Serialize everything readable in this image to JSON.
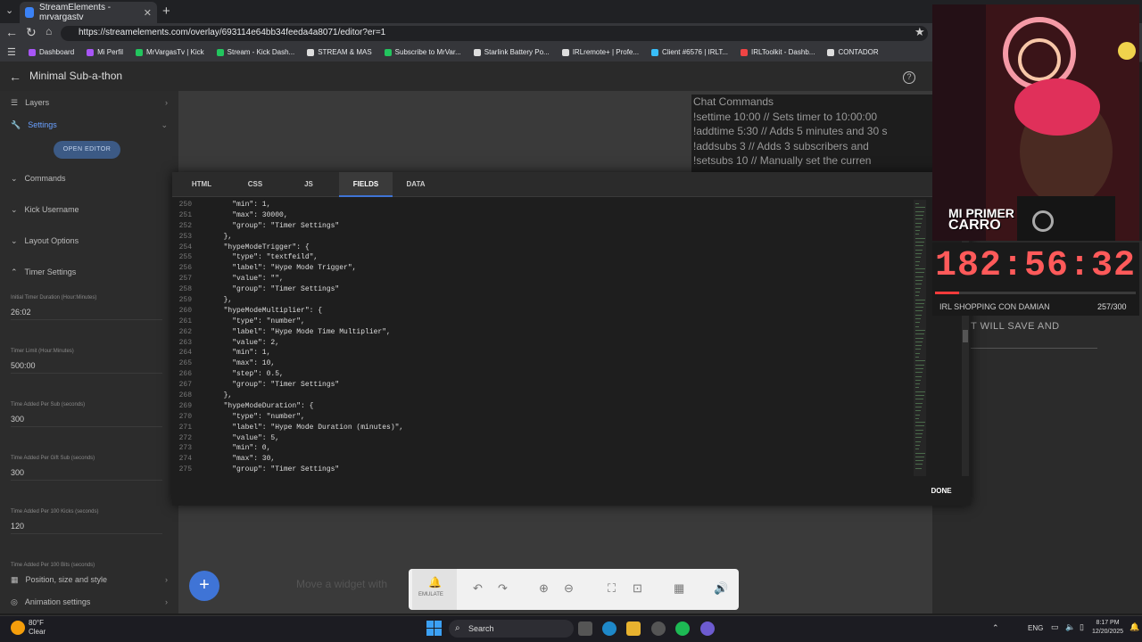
{
  "browser": {
    "tab_title": "StreamElements - mrvargastv",
    "url": "https://streamelements.com/overlay/693114e64bb34feeda4a8071/editor?er=1",
    "bookmarks": [
      {
        "label": "Dashboard",
        "color": "#a855f7"
      },
      {
        "label": "Mi Perfil",
        "color": "#a855f7"
      },
      {
        "label": "MrVargasTv | Kick",
        "color": "#22c55e"
      },
      {
        "label": "Stream - Kick Dash...",
        "color": "#22c55e"
      },
      {
        "label": "STREAM & MAS",
        "color": "#ddd"
      },
      {
        "label": "Subscribe to MrVar...",
        "color": "#22c55e"
      },
      {
        "label": "Starlink Battery Po...",
        "color": "#ddd"
      },
      {
        "label": "IRLremote+ | Profe...",
        "color": "#ddd"
      },
      {
        "label": "Client #6576 | IRLT...",
        "color": "#38bdf8"
      },
      {
        "label": "IRLToolkit - Dashb...",
        "color": "#ef4444"
      },
      {
        "label": "CONTADOR",
        "color": "#ddd"
      }
    ]
  },
  "editor": {
    "overlay_title": "Minimal Sub-a-thon",
    "sidebar": {
      "layers": "Layers",
      "settings": "Settings",
      "open_editor": "OPEN EDITOR",
      "sections": [
        "Commands",
        "Kick Username",
        "Layout Options",
        "Timer Settings"
      ],
      "fields": [
        {
          "label": "Initial Timer Duration (Hour:Minutes)",
          "value": "26:02"
        },
        {
          "label": "Timer Limit (Hour:Minutes)",
          "value": "500:00"
        },
        {
          "label": "Time Added Per Sub (seconds)",
          "value": "300"
        },
        {
          "label": "Time Added Per Gift Sub (seconds)",
          "value": "300"
        },
        {
          "label": "Time Added Per 100 Kicks (seconds)",
          "value": "120"
        },
        {
          "label": "Time Added Per 100 Bits (seconds)",
          "value": ""
        }
      ],
      "bottom": [
        "Position, size and style",
        "Animation settings"
      ]
    },
    "canvas_hint": "Move a widget with",
    "toolbar": {
      "emulate": "EMULATE"
    }
  },
  "modal": {
    "tabs": [
      "HTML",
      "CSS",
      "JS",
      "FIELDS",
      "DATA"
    ],
    "active_tab": "FIELDS",
    "done": "DONE",
    "code_lines": [
      {
        "n": "250",
        "t": "    \"min\": 1,"
      },
      {
        "n": "251",
        "t": "    \"max\": 30000,"
      },
      {
        "n": "252",
        "t": "    \"group\": \"Timer Settings\""
      },
      {
        "n": "253",
        "t": "  },"
      },
      {
        "n": "254",
        "t": "  \"hypeModeTrigger\": {"
      },
      {
        "n": "255",
        "t": "    \"type\": \"textfeild\","
      },
      {
        "n": "256",
        "t": "    \"label\": \"Hype Mode Trigger\","
      },
      {
        "n": "257",
        "t": "    \"value\": \"\","
      },
      {
        "n": "258",
        "t": "    \"group\": \"Timer Settings\""
      },
      {
        "n": "259",
        "t": "  },"
      },
      {
        "n": "260",
        "t": "  \"hypeModeMultiplier\": {"
      },
      {
        "n": "261",
        "t": "    \"type\": \"number\","
      },
      {
        "n": "262",
        "t": "    \"label\": \"Hype Mode Time Multiplier\","
      },
      {
        "n": "263",
        "t": "    \"value\": 2,"
      },
      {
        "n": "264",
        "t": "    \"min\": 1,"
      },
      {
        "n": "265",
        "t": "    \"max\": 10,"
      },
      {
        "n": "266",
        "t": "    \"step\": 0.5,"
      },
      {
        "n": "267",
        "t": "    \"group\": \"Timer Settings\""
      },
      {
        "n": "268",
        "t": "  },"
      },
      {
        "n": "269",
        "t": "  \"hypeModeDuration\": {"
      },
      {
        "n": "270",
        "t": "    \"type\": \"number\","
      },
      {
        "n": "271",
        "t": "    \"label\": \"Hype Mode Duration (minutes)\","
      },
      {
        "n": "272",
        "t": "    \"value\": 5,"
      },
      {
        "n": "273",
        "t": "    \"min\": 0,"
      },
      {
        "n": "274",
        "t": "    \"max\": 30,"
      },
      {
        "n": "275",
        "t": "    \"group\": \"Timer Settings\""
      }
    ]
  },
  "overlay": {
    "chat_commands": {
      "title": "Chat Commands",
      "lines": [
        "!settime 10:00 // Sets timer to 10:00:00",
        "!addtime 5:30  // Adds 5 minutes and 30 s",
        "!addsubs 3     // Adds 3 subscribers and",
        "!setsubs 10    // Manually set the curren"
      ]
    },
    "will_save": "T WILL SAVE AND",
    "timer": "182:56:32",
    "goal_label": "IRL SHOPPING CON DAMIAN",
    "goal_count": "257/300",
    "goal_progress": 0.12,
    "banner": [
      "MI PRIMER",
      "CARRO"
    ]
  },
  "taskbar": {
    "weather_temp": "80°F",
    "weather_desc": "Clear",
    "search": "Search",
    "lang": "ENG",
    "time": "8:17 PM",
    "date": "12/20/2025"
  }
}
